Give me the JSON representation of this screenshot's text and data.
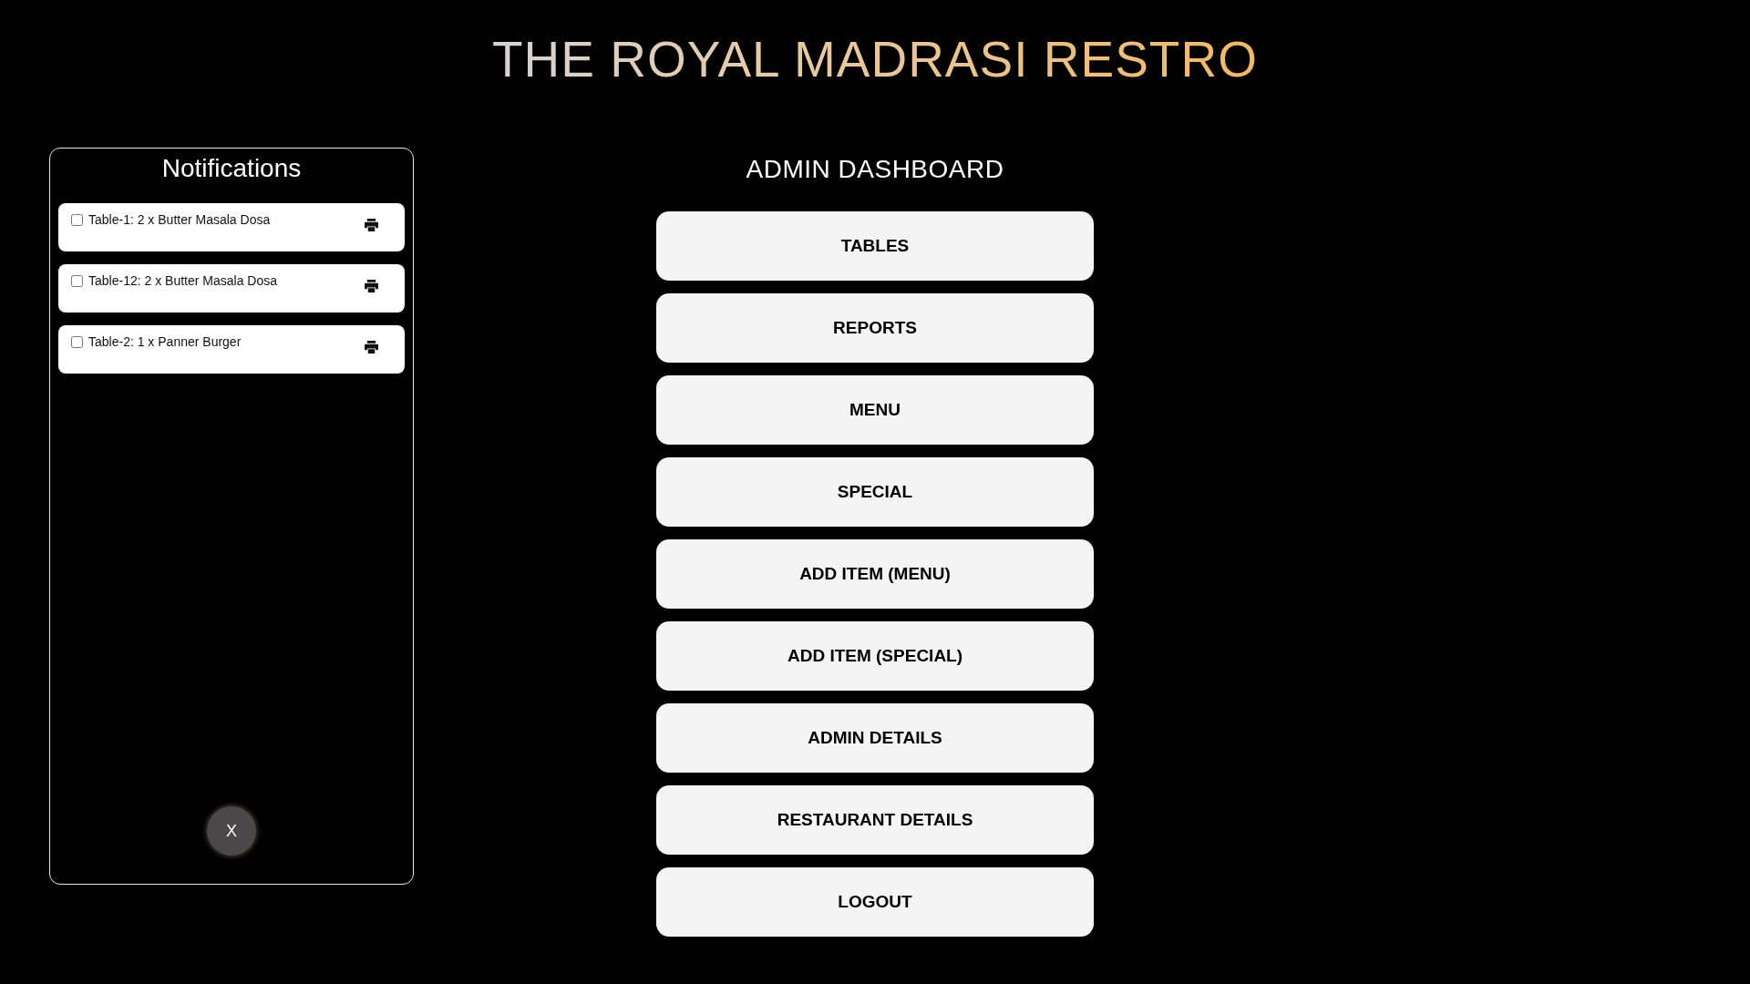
{
  "header": {
    "title": "THE ROYAL MADRASI RESTRO"
  },
  "notifications": {
    "title": "Notifications",
    "items": [
      {
        "text": "Table-1: 2 x Butter Masala Dosa",
        "checked": false
      },
      {
        "text": "Table-12: 2 x Butter Masala Dosa",
        "checked": false
      },
      {
        "text": "Table-2: 1 x Panner Burger",
        "checked": false
      }
    ],
    "close_button": "X"
  },
  "dashboard": {
    "title": "ADMIN DASHBOARD",
    "buttons": [
      "TABLES",
      "REPORTS",
      "MENU",
      "SPECIAL",
      "ADD ITEM (MENU)",
      "ADD ITEM (SPECIAL)",
      "ADMIN DETAILS",
      "RESTAURANT DETAILS",
      "LOGOUT"
    ]
  }
}
